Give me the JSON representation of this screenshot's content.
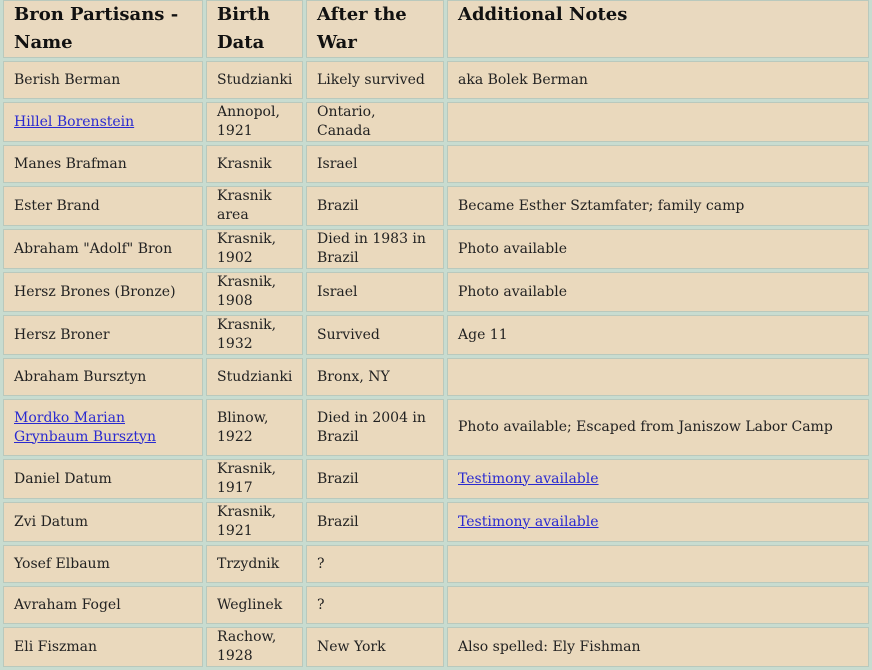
{
  "headers": [
    "Bron Partisans - Name",
    "Birth Data",
    "After the War",
    "Additional Notes"
  ],
  "rows": [
    {
      "name": "Berish Berman",
      "birth": "Studzianki",
      "after": "Likely survived",
      "notes": "aka Bolek Berman"
    },
    {
      "name": "Hillel Borenstein",
      "name_link": true,
      "birth": "Annopol, 1921",
      "after": "Ontario, Canada",
      "notes": ""
    },
    {
      "name": "Manes Brafman",
      "birth": "Krasnik",
      "after": "Israel",
      "notes": ""
    },
    {
      "name": "Ester Brand",
      "birth": "Krasnik area",
      "after": "Brazil",
      "notes": "Became Esther Sztamfater; family camp"
    },
    {
      "name": "Abraham \"Adolf\" Bron",
      "birth": "Krasnik, 1902",
      "after": "Died in 1983 in Brazil",
      "notes": "Photo available"
    },
    {
      "name": "Hersz Brones (Bronze)",
      "birth": "Krasnik, 1908",
      "after": "Israel",
      "notes": "Photo available"
    },
    {
      "name": "Hersz Broner",
      "birth": "Krasnik, 1932",
      "after": "Survived",
      "notes": "Age 11"
    },
    {
      "name": "Abraham Bursztyn",
      "birth": "Studzianki",
      "after": "Bronx, NY",
      "notes": ""
    },
    {
      "name_lines": [
        "Mordko Marian",
        "Grynbaum Bursztyn"
      ],
      "name_link": true,
      "birth": "Blinow, 1922",
      "after": "Died in 2004 in Brazil",
      "notes": "Photo available; Escaped from Janiszow Labor Camp"
    },
    {
      "name": "Daniel Datum",
      "birth": "Krasnik, 1917",
      "after": "Brazil",
      "notes": "Testimony available",
      "notes_link": true
    },
    {
      "name": "Zvi Datum",
      "birth": "Krasnik, 1921",
      "after": "Brazil",
      "notes": "Testimony available",
      "notes_link": true
    },
    {
      "name": "Yosef Elbaum",
      "birth": "Trzydnik",
      "after": "?",
      "notes": ""
    },
    {
      "name": "Avraham Fogel",
      "birth": "Weglinek",
      "after": "?",
      "notes": ""
    },
    {
      "name": "Eli Fiszman",
      "birth": "Rachow, 1928",
      "after": "New York",
      "notes": "Also spelled: Ely Fishman"
    }
  ],
  "colors": {
    "background": "#e9d9bf",
    "grid": "#c8dcd0",
    "link": "#2a2ad0"
  }
}
